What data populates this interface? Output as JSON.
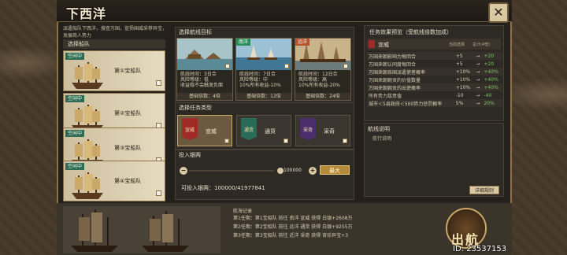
{
  "title": "下西洋",
  "intro": "派遣船队下西洋，搜查万国，宣扬国威采荐异宝，发展商人势力",
  "fleet": {
    "header": "选择船队",
    "items": [
      {
        "status": "空闲中",
        "name": "第①宝船队"
      },
      {
        "status": "空闲中",
        "name": "第②宝船队"
      },
      {
        "status": "空闲中",
        "name": "第③宝船队"
      },
      {
        "status": "空闲中",
        "name": "第④宝船队"
      }
    ]
  },
  "route": {
    "header": "选择航线目标",
    "cards": [
      {
        "tag": "",
        "tag_color": "#2a8f5a",
        "time": "航线时间：3日合",
        "risk": "风险等级：低",
        "yield": "收益稳不会触发负面",
        "mult": "基础倍数：4倍"
      },
      {
        "tag": "南洋",
        "tag_color": "#2a8f5a",
        "time": "航线时间：7日合",
        "risk": "风险等级：中",
        "yield": "10%所有收益-10%",
        "mult": "基础倍数：12倍"
      },
      {
        "tag": "远洋",
        "tag_color": "#b5532c",
        "time": "航线时间：12日合",
        "risk": "风险等级：高",
        "yield": "10%所有收益-20%",
        "mult": "基础倍数：24倍"
      }
    ]
  },
  "task": {
    "header": "选择任务类型",
    "items": [
      {
        "label": "宣威",
        "badge": "宣威",
        "badge_color": "#9e2b25"
      },
      {
        "label": "通货",
        "badge": "通货",
        "badge_color": "#2a6b57"
      },
      {
        "label": "采奇",
        "badge": "采奇",
        "badge_color": "#4b2e6b"
      }
    ]
  },
  "silver": {
    "header": "投入银两",
    "minus": "−",
    "plus": "+",
    "value": "100000",
    "max": "最大",
    "available": "可投入银两：100000/41977841"
  },
  "effects": {
    "header": "任务效果预览（受航线倍数加成）",
    "section": "宣威",
    "col_current": "当前选择",
    "col_total": "总计(4倍)",
    "rows": [
      {
        "name": "万国来朝影响力每回合",
        "cur": "+5",
        "arrow": "→",
        "total": "+20"
      },
      {
        "name": "万国来朝认同度每回合",
        "cur": "+5",
        "arrow": "→",
        "total": "+20"
      },
      {
        "name": "万国来朝各国派遣使者概率",
        "cur": "+10%",
        "arrow": "→",
        "total": "+40%"
      },
      {
        "name": "万国来朝朝贡的价值数量",
        "cur": "+10%",
        "arrow": "→",
        "total": "+40%"
      },
      {
        "name": "万国来朝朝贡的出使概率",
        "cur": "+10%",
        "arrow": "→",
        "total": "+40%"
      },
      {
        "name": "所有势力敌意值",
        "cur": "-10",
        "arrow": "→",
        "total": "-40"
      },
      {
        "name": "城市＜5县政府＜500势力惩罚概率",
        "cur": "5%",
        "arrow": "→",
        "total": "20%"
      }
    ]
  },
  "route_desc": {
    "header": "航线说明",
    "text": "航行说明",
    "detail_button": "详细规则"
  },
  "log": {
    "title": "航海记录",
    "lines": [
      "第1任期：第1宝船队 前往 南洋 宣威 获得 白银+2608万",
      "第2任期：第2宝船队 前往 远洋 通货 获得 白银+9255万",
      "第3任期：第3宝船队 前往 近洋 采奇 获得 奇珍异宝+3"
    ]
  },
  "sail_button": "出航",
  "uid": "ID: 23537153"
}
